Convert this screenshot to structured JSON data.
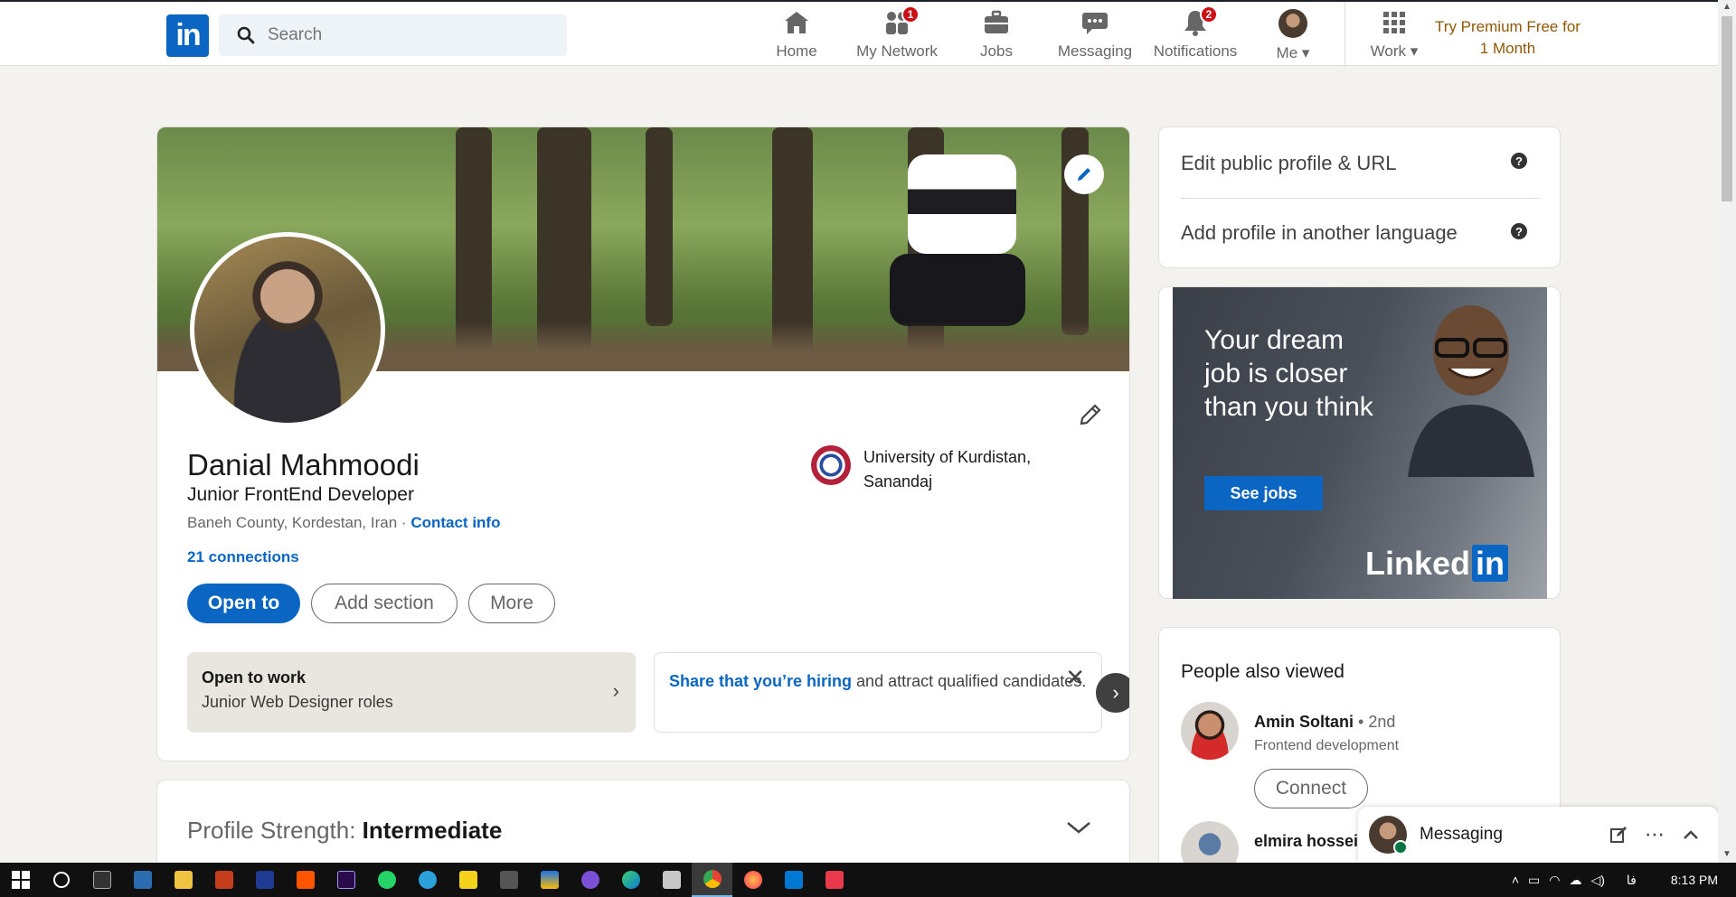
{
  "nav": {
    "search_placeholder": "Search",
    "items": [
      {
        "label": "Home"
      },
      {
        "label": "My Network",
        "badge": "1"
      },
      {
        "label": "Jobs"
      },
      {
        "label": "Messaging"
      },
      {
        "label": "Notifications",
        "badge": "2"
      },
      {
        "label": "Me"
      },
      {
        "label": "Work"
      }
    ],
    "premium": "Try Premium Free for 1 Month",
    "logo": "in"
  },
  "profile": {
    "name": "Danial Mahmoodi",
    "headline": "Junior FrontEnd Developer",
    "location": "Baneh County, Kordestan, Iran",
    "separator": "·",
    "contact_info": "Contact info",
    "connections": "21 connections",
    "education": "University of Kurdistan, Sanandaj",
    "buttons": {
      "open_to": "Open to",
      "add_section": "Add section",
      "more": "More"
    },
    "open_to_work": {
      "title": "Open to work",
      "roles": "Junior Web Designer roles"
    },
    "hiring": {
      "link": "Share that you’re hiring",
      "rest": " and attract qualified candidates."
    }
  },
  "strength": {
    "label": "Profile Strength:",
    "value": "Intermediate"
  },
  "rail": {
    "edit_public_profile": "Edit public profile & URL",
    "add_language": "Add profile in another language",
    "help": "?"
  },
  "ad": {
    "headline": "Your dream job is closer than you think",
    "button": "See jobs",
    "brand": "Linked",
    "brand_in": "in"
  },
  "people_also_viewed": {
    "title": "People also viewed",
    "people": [
      {
        "name": "Amin Soltani",
        "degree": " • 2nd",
        "headline": "Frontend development",
        "action": "Connect"
      },
      {
        "name": "elmira hossei"
      }
    ]
  },
  "messaging": {
    "title": "Messaging"
  },
  "taskbar": {
    "time": "8:13 PM",
    "lang": "فا"
  },
  "colors": {
    "accent": "#0a66c2",
    "premium": "#915907",
    "badge": "#cc1016"
  }
}
